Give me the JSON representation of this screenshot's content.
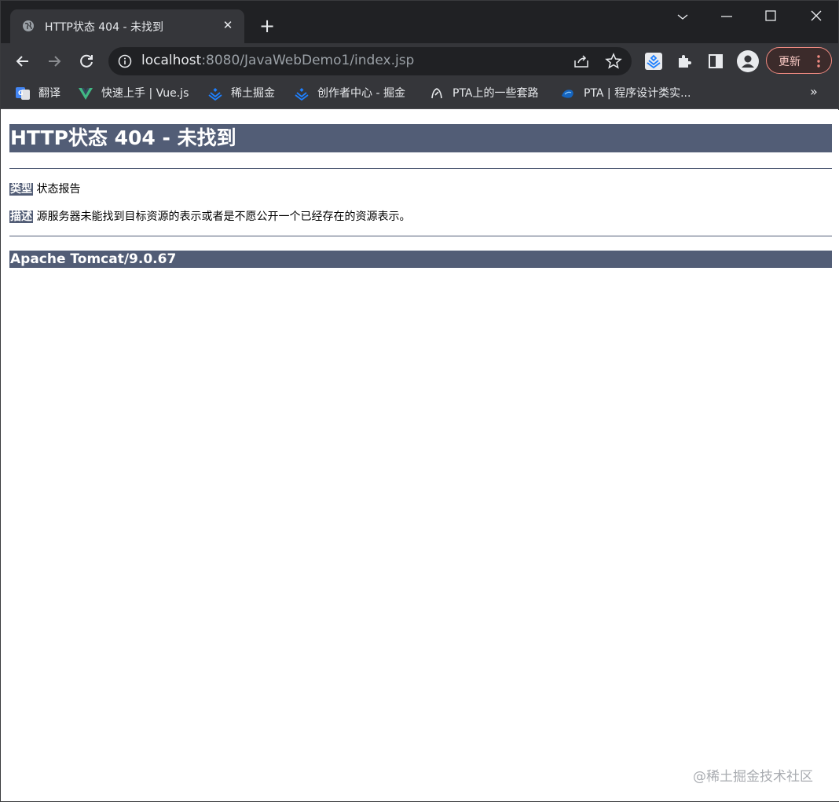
{
  "tab": {
    "title": "HTTP状态 404 - 未找到"
  },
  "toolbar": {
    "url_host": "localhost",
    "url_rest": ":8080/JavaWebDemo1/index.jsp",
    "update_label": "更新"
  },
  "bookmarks": [
    {
      "label": "翻译",
      "icon": "google-translate-icon"
    },
    {
      "label": "快速上手 | Vue.js",
      "icon": "vue-icon"
    },
    {
      "label": "稀土掘金",
      "icon": "juejin-icon"
    },
    {
      "label": "创作者中心 - 掘金",
      "icon": "juejin-icon"
    },
    {
      "label": "PTA上的一些套路",
      "icon": "pta-icon"
    },
    {
      "label": "PTA | 程序设计类实...",
      "icon": "pta-blue-icon"
    }
  ],
  "page": {
    "heading": "HTTP状态 404 - 未找到",
    "type_label": "类型",
    "type_value": "状态报告",
    "desc_label": "描述",
    "desc_value": "源服务器未能找到目标资源的表示或者是不愿公开一个已经存在的资源表示。",
    "server": "Apache Tomcat/9.0.67"
  },
  "watermark": "@稀土掘金技术社区",
  "colors": {
    "tomcat_header": "#525d76",
    "chrome_dark": "#202124",
    "chrome_toolbar": "#35363a",
    "update_accent": "#f28b82"
  }
}
